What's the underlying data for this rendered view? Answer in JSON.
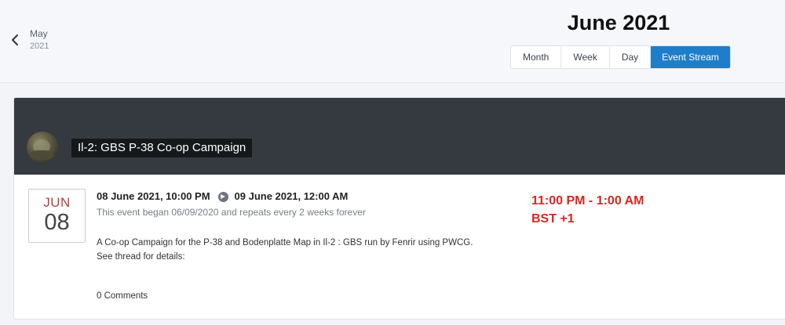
{
  "nav": {
    "prev_month": "May",
    "prev_year": "2021",
    "title": "June 2021",
    "views": [
      "Month",
      "Week",
      "Day",
      "Event Stream"
    ],
    "active_view": "Event Stream"
  },
  "event": {
    "title": "Il-2: GBS P-38 Co-op Campaign",
    "date_month": "JUN",
    "date_day": "08",
    "start": "08 June 2021, 10:00 PM",
    "end": "09 June 2021, 12:00 AM",
    "recurrence": "This event began 06/09/2020 and repeats every 2 weeks forever",
    "description_line1": "A Co-op Campaign for the P-38 and Bodenplatte Map in Il-2 : GBS run by Fenrir using PWCG.",
    "description_line2": "See thread for details:",
    "comments": "0 Comments"
  },
  "annotation": {
    "line1": "11:00 PM - 1:00 AM",
    "line2": "BST +1"
  },
  "colors": {
    "accent": "#1f7ec9",
    "banner": "#353a40",
    "date_month": "#b8403b",
    "annotation": "#d9261f"
  },
  "icons": [
    "chevron-left-icon",
    "arrow-right-circle-icon",
    "avatar"
  ]
}
